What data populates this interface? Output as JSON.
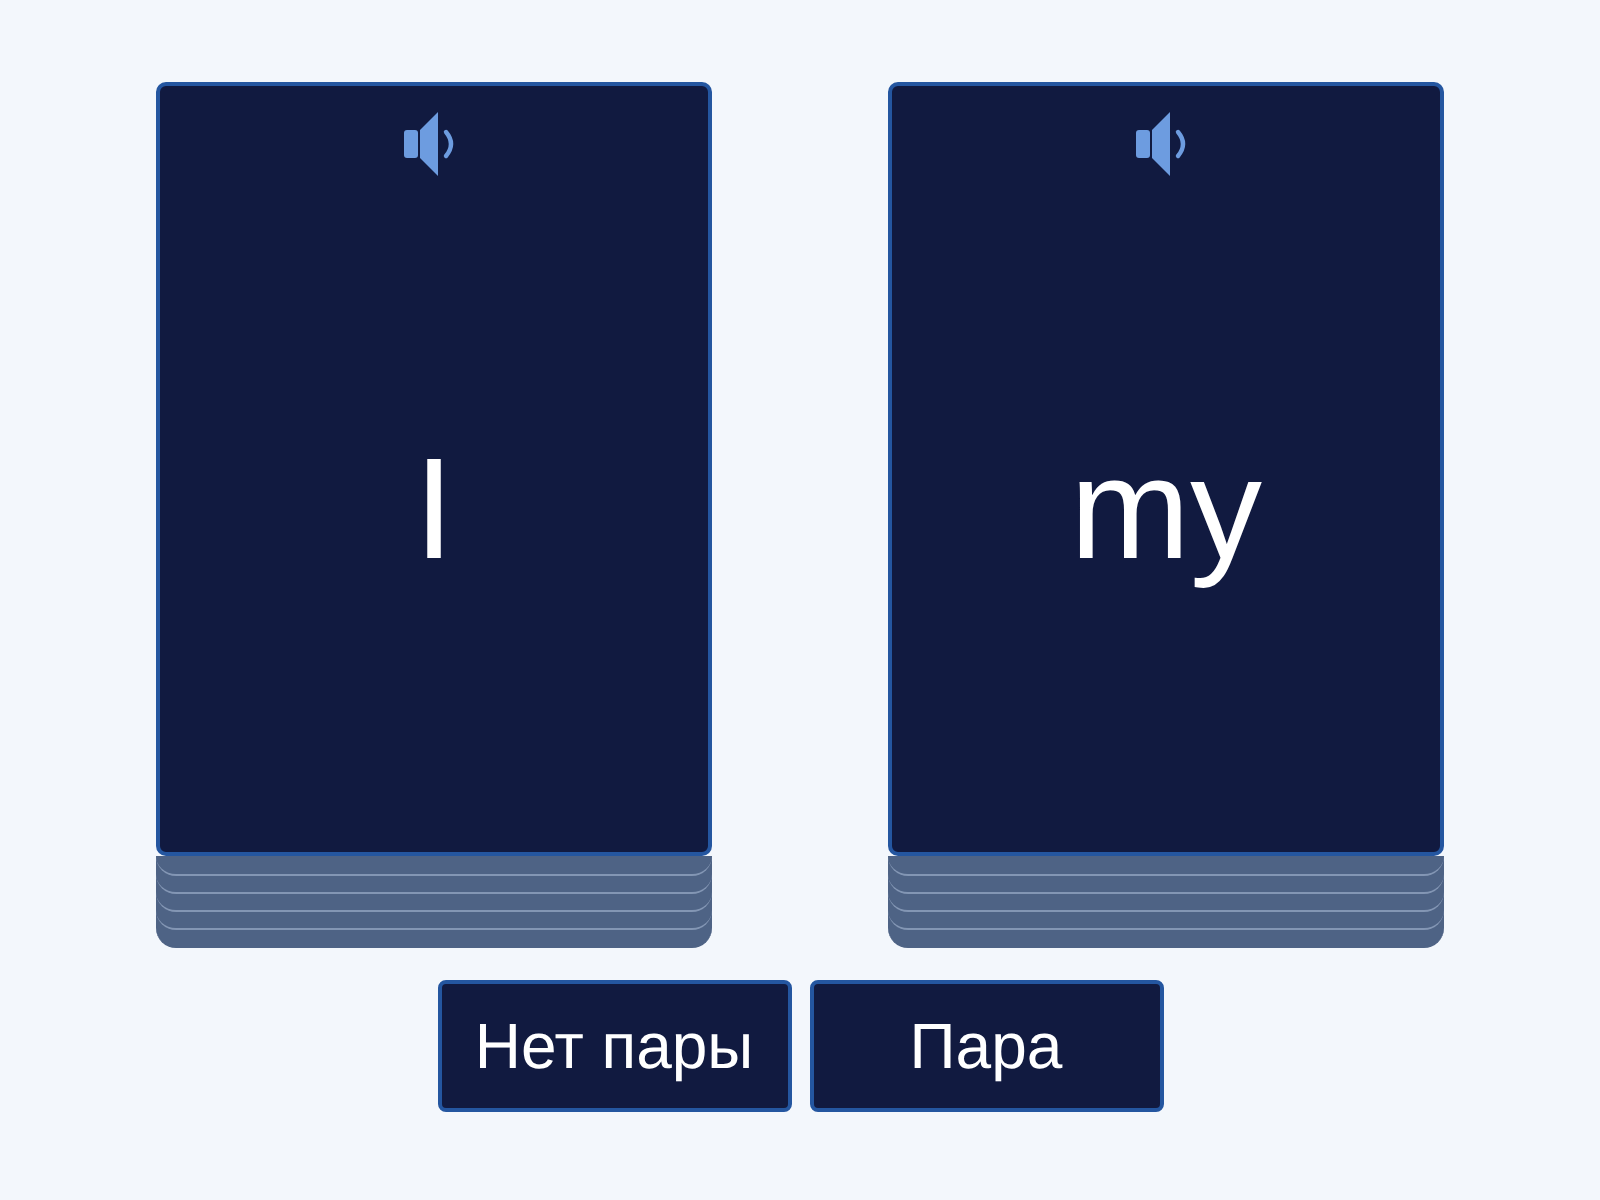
{
  "cards": [
    {
      "word": "I"
    },
    {
      "word": "my"
    }
  ],
  "buttons": [
    {
      "label": "Нет пары"
    },
    {
      "label": "Пара"
    }
  ]
}
